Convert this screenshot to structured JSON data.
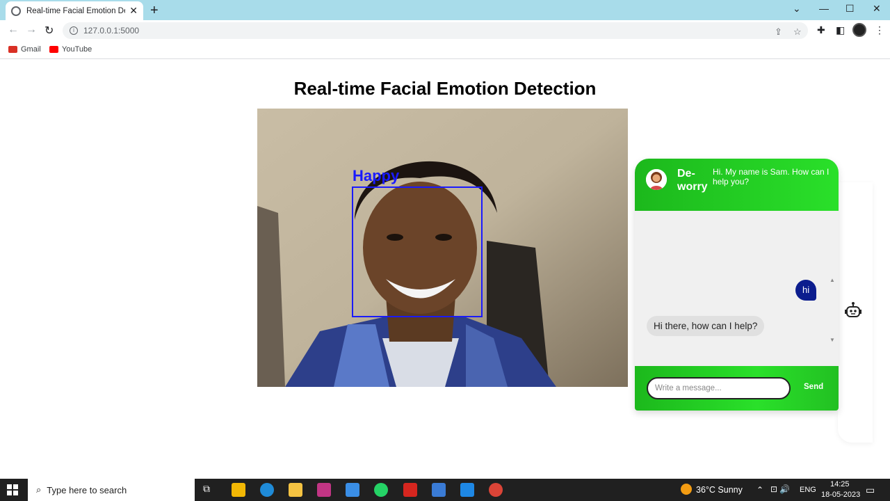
{
  "browser": {
    "tab_title": "Real-time Facial Emotion Detection",
    "url": "127.0.0.1:5000",
    "bookmarks": [
      {
        "label": "Gmail",
        "icon": "gmail-icon",
        "color": "#d93025"
      },
      {
        "label": "YouTube",
        "icon": "youtube-icon",
        "color": "#ff0000"
      }
    ]
  },
  "page": {
    "title": "Real-time Facial Emotion Detection",
    "detected_emotion": "Happy"
  },
  "chat": {
    "bot_name": "De-worry",
    "greeting": "Hi. My name is Sam. How can I help you?",
    "messages": [
      {
        "from": "user",
        "text": "hi"
      },
      {
        "from": "bot",
        "text": "Hi there, how can I help?"
      }
    ],
    "input_placeholder": "Write a message...",
    "input_value": "",
    "send_label": "Send",
    "accent_color": "#2ae02a",
    "user_bubble_color": "#0c1d8e"
  },
  "taskbar": {
    "search_placeholder": "Type here to search",
    "weather": "36°C  Sunny",
    "language": "ENG",
    "time": "14:25",
    "date": "18-05-2023"
  }
}
